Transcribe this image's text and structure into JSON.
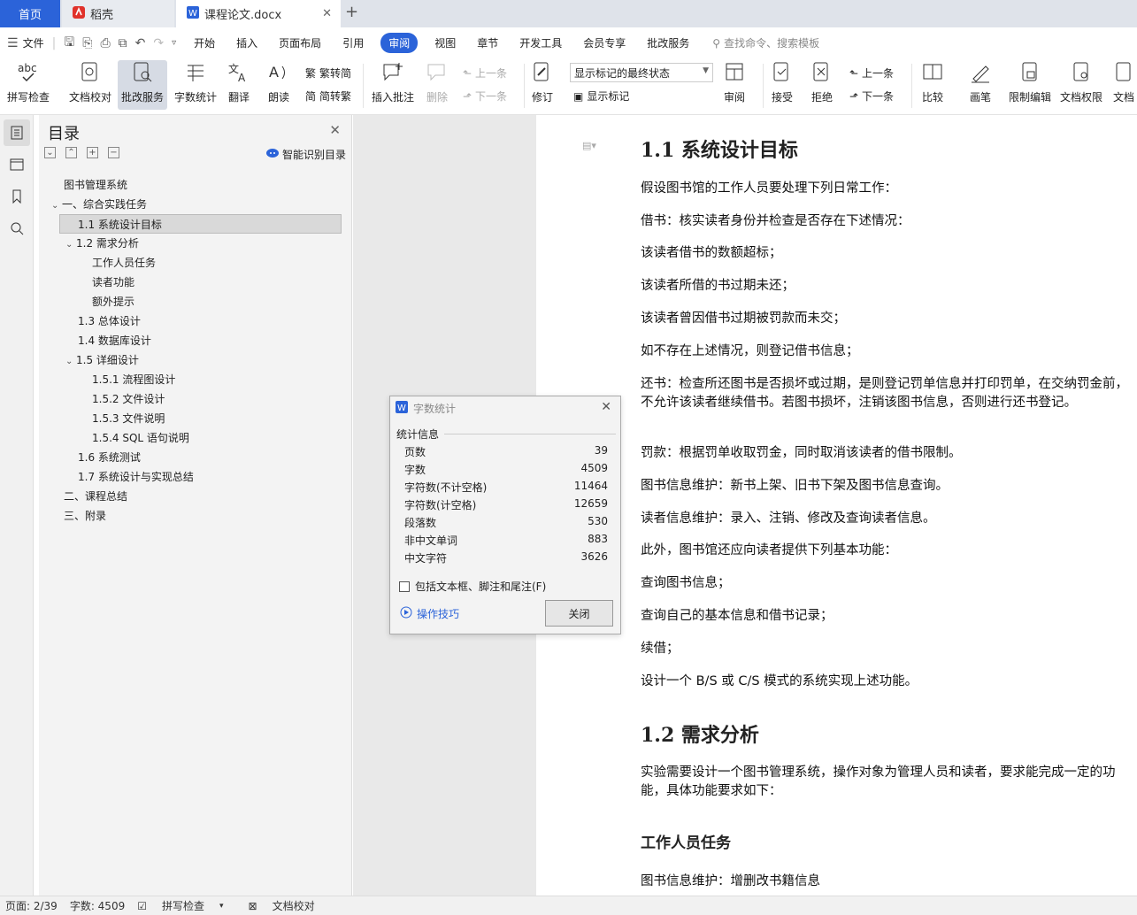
{
  "tabs": {
    "home": "首页",
    "wps": "稻壳",
    "doc": "课程论文.docx"
  },
  "menu": {
    "file": "文件",
    "items": [
      "开始",
      "插入",
      "页面布局",
      "引用",
      "审阅",
      "视图",
      "章节",
      "开发工具",
      "会员专享",
      "批改服务"
    ],
    "active": "审阅",
    "search": "查找命令、搜索模板"
  },
  "ribbon": {
    "spell": "拼写检查",
    "proof": "文档校对",
    "review_service": "批改服务",
    "word_count": "字数统计",
    "translate": "翻译",
    "read_aloud": "朗读",
    "trad": "繁转简",
    "simp": "简转繁",
    "insert_comment": "插入批注",
    "delete": "删除",
    "prev": "上一条",
    "next": "下一条",
    "track": "修订",
    "markup_state": "显示标记的最终状态",
    "show_markup": "显示标记",
    "review": "审阅",
    "accept": "接受",
    "reject": "拒绝",
    "prev2": "上一条",
    "next2": "下一条",
    "compare": "比较",
    "pen": "画笔",
    "restrict": "限制编辑",
    "permission": "文档权限",
    "doc_more": "文档"
  },
  "toc": {
    "title": "目录",
    "ai": "智能识别目录",
    "items": [
      {
        "text": "图书管理系统"
      },
      {
        "text": "一、综合实践任务"
      },
      {
        "text": "1.1  系统设计目标"
      },
      {
        "text": "1.2  需求分析"
      },
      {
        "text": "工作人员任务"
      },
      {
        "text": "读者功能"
      },
      {
        "text": "额外提示"
      },
      {
        "text": "1.3  总体设计"
      },
      {
        "text": "1.4  数据库设计"
      },
      {
        "text": "1.5  详细设计"
      },
      {
        "text": "1.5.1  流程图设计"
      },
      {
        "text": "1.5.2  文件设计"
      },
      {
        "text": "1.5.3  文件说明"
      },
      {
        "text": "1.5.4 SQL  语句说明"
      },
      {
        "text": "1.6  系统测试"
      },
      {
        "text": "1.7  系统设计与实现总结"
      },
      {
        "text": "二、课程总结"
      },
      {
        "text": "三、附录"
      }
    ]
  },
  "doc": {
    "h1": "1.1  系统设计目标",
    "p": [
      "假设图书馆的工作人员要处理下列日常工作：",
      "借书：核实读者身份并检查是否存在下述情况：",
      "该读者借书的数额超标；",
      "该读者所借的书过期未还；",
      "该读者曾因借书过期被罚款而未交；",
      "如不存在上述情况，则登记借书信息；",
      "还书：检查所还图书是否损坏或过期，是则登记罚单信息并打印罚单，在交纳罚金前，不允许该读者继续借书。若图书损坏，注销该图书信息，否则进行还书登记。",
      "罚款：根据罚单收取罚金，同时取消该读者的借书限制。",
      "图书信息维护：新书上架、旧书下架及图书信息查询。",
      "读者信息维护：录入、注销、修改及查询读者信息。",
      "此外，图书馆还应向读者提供下列基本功能：",
      "查询图书信息；",
      "查询自己的基本信息和借书记录；",
      "续借；",
      "设计一个  B/S  或  C/S  模式的系统实现上述功能。"
    ],
    "h2": "1.2  需求分析",
    "p2": "实验需要设计一个图书管理系统，操作对象为管理人员和读者，要求能完成一定的功能，具体功能要求如下：",
    "h3": "工作人员任务",
    "p3": "图书信息维护：增删改书籍信息"
  },
  "dialog": {
    "title": "字数统计",
    "section": "统计信息",
    "rows": [
      {
        "label": "页数",
        "value": "39"
      },
      {
        "label": "字数",
        "value": "4509"
      },
      {
        "label": "字符数(不计空格)",
        "value": "11464"
      },
      {
        "label": "字符数(计空格)",
        "value": "12659"
      },
      {
        "label": "段落数",
        "value": "530"
      },
      {
        "label": "非中文单词",
        "value": "883"
      },
      {
        "label": "中文字符",
        "value": "3626"
      }
    ],
    "checkbox": "包括文本框、脚注和尾注(F)",
    "tips": "操作技巧",
    "close": "关闭"
  },
  "status": {
    "page": "页面: 2/39",
    "words": "字数: 4509",
    "spell": "拼写检查",
    "proof": "文档校对"
  },
  "colors": {
    "accent": "#2b63d9",
    "wps_red": "#e0322b"
  }
}
